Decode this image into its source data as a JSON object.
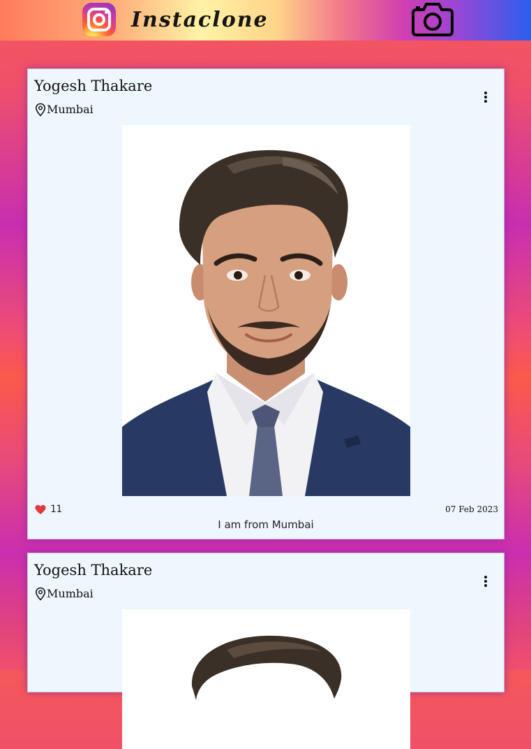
{
  "app": {
    "name": "Instaclone",
    "logo_icon": "instagram-logo-icon",
    "camera_icon": "camera-icon"
  },
  "colors": {
    "card_background": "#eef6fe",
    "like_heart": "#e23b3b",
    "text": "#111111"
  },
  "posts": [
    {
      "author": "Yogesh Thakare",
      "location": "Mumbai",
      "likes": "11",
      "date": "07 Feb 2023",
      "description": "I am from Mumbai",
      "menu_icon": "more-vertical-icon",
      "location_icon": "location-pin-icon",
      "like_icon": "heart-icon"
    },
    {
      "author": "Yogesh Thakare",
      "location": "Mumbai",
      "menu_icon": "more-vertical-icon",
      "location_icon": "location-pin-icon"
    }
  ]
}
